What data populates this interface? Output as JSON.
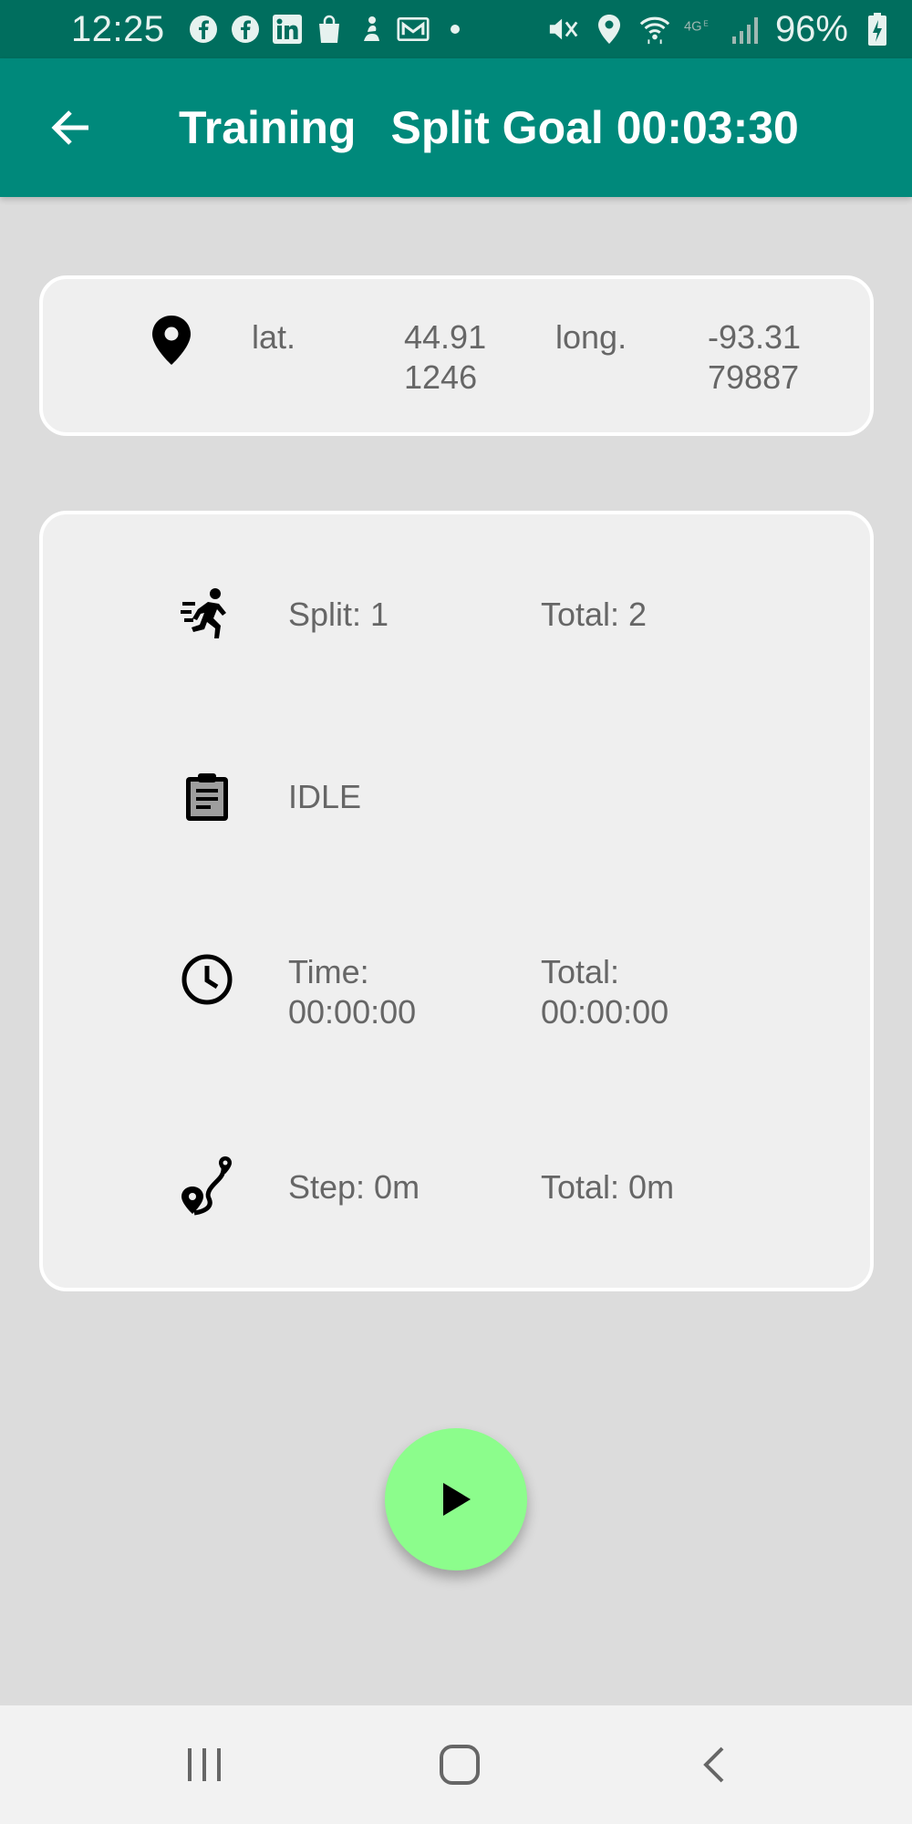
{
  "status_bar": {
    "time": "12:25",
    "battery": "96%",
    "left_icons": [
      "facebook-icon",
      "facebook-icon",
      "linkedin-icon",
      "shopping-bag-icon",
      "app-icon",
      "mail-icon",
      "dot-icon"
    ],
    "right_icons": [
      "mute-icon",
      "location-icon",
      "wifi-icon",
      "4g-icon",
      "signal-icon",
      "battery-charging-icon"
    ]
  },
  "app_bar": {
    "title": "Training",
    "subtitle": "Split Goal 00:03:30",
    "color": "#00897b"
  },
  "location": {
    "lat_label": "lat.",
    "lat_value": "44.91\n1246",
    "long_label": "long.",
    "long_value": "-93.31\n79887"
  },
  "stats": {
    "split": "Split: 1",
    "split_total": "Total: 2",
    "state": "IDLE",
    "time": "Time:\n00:00:00",
    "time_total": "Total:\n00:00:00",
    "step": "Step: 0m",
    "step_total": "Total: 0m"
  },
  "fab": {
    "icon": "play-icon",
    "color": "#8cfd8c"
  },
  "nav": {
    "items": [
      "recent-apps-icon",
      "home-icon",
      "back-icon"
    ]
  }
}
